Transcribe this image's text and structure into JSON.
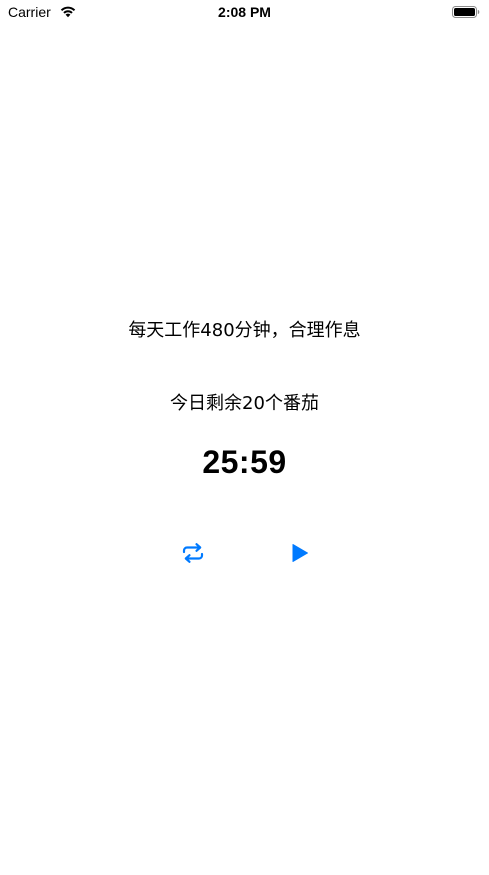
{
  "status_bar": {
    "carrier": "Carrier",
    "time": "2:08 PM"
  },
  "main": {
    "motto": "每天工作480分钟，合理作息",
    "remaining": "今日剩余20个番茄",
    "timer": "25:59"
  },
  "controls": {
    "reset_icon": "repeat-icon",
    "play_icon": "play-icon"
  },
  "colors": {
    "accent": "#007AFF",
    "text": "#000000",
    "background": "#FFFFFF"
  }
}
